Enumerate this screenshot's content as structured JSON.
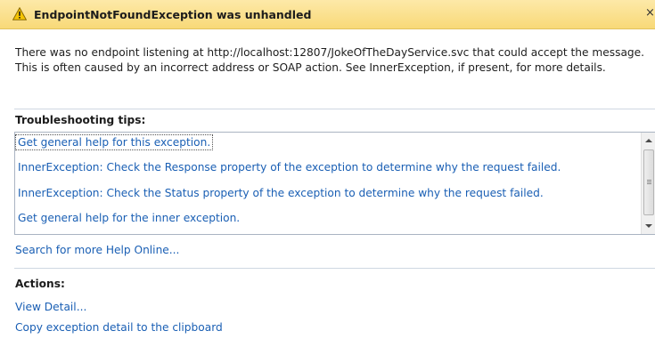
{
  "dialog": {
    "title": "EndpointNotFoundException was unhandled",
    "close_glyph": "×",
    "icon": "warning-icon",
    "message": "There was no endpoint listening at http://localhost:12807/JokeOfTheDayService.svc that could accept the message. This is often caused by an incorrect address or SOAP action. See InnerException, if present, for more details."
  },
  "troubleshooting": {
    "header": "Troubleshooting tips:",
    "tips": [
      "Get general help for this exception.",
      "InnerException: Check the Response property of the exception to determine why the request failed.",
      "InnerException: Check the Status property of the exception to determine why the request failed.",
      "Get general help for the inner exception."
    ],
    "search_link": "Search for more Help Online..."
  },
  "actions": {
    "header": "Actions:",
    "items": [
      "View Detail...",
      "Copy exception detail to the clipboard"
    ]
  },
  "colors": {
    "title_bar": "#f8d978",
    "link": "#1a5fb4",
    "warning_fill": "#f5c400"
  }
}
